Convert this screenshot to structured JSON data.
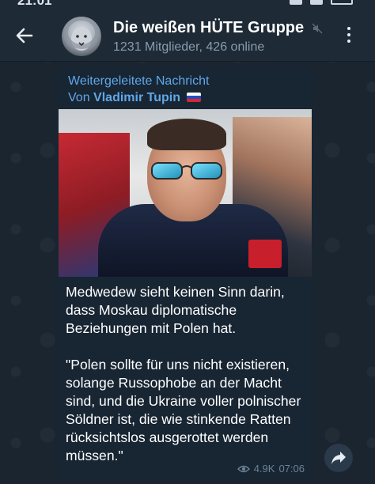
{
  "status_bar": {
    "time": "21:01"
  },
  "header": {
    "title": "Die weißen HÜTE Gruppe",
    "subtitle": "1231 Mitglieder, 426 online",
    "muted": true
  },
  "message": {
    "forward_label": "Weitergeleitete Nachricht",
    "forward_from_prefix": "Von",
    "forward_from_name": "Vladimir Tupin",
    "forward_from_flag": "🇷🇺",
    "paragraphs": [
      "Medwedew sieht keinen Sinn darin, dass Moskau diplomatische Beziehungen mit Polen hat.",
      "\"Polen sollte für uns nicht existieren, solange Russophobe an der Macht sind, und die Ukraine voller polnischer Söldner ist, die wie stinkende Ratten rücksichtslos ausgerottet werden müssen.\""
    ],
    "views": "4.9K",
    "time": "07:06"
  },
  "colors": {
    "background": "#0e1621",
    "header": "#1e2a36",
    "bubble": "#182533",
    "link": "#5fa8e8",
    "meta": "#6d8397"
  },
  "icons": [
    "back-arrow-icon",
    "mute-icon",
    "more-vertical-icon",
    "eye-icon",
    "share-arrow-icon"
  ]
}
